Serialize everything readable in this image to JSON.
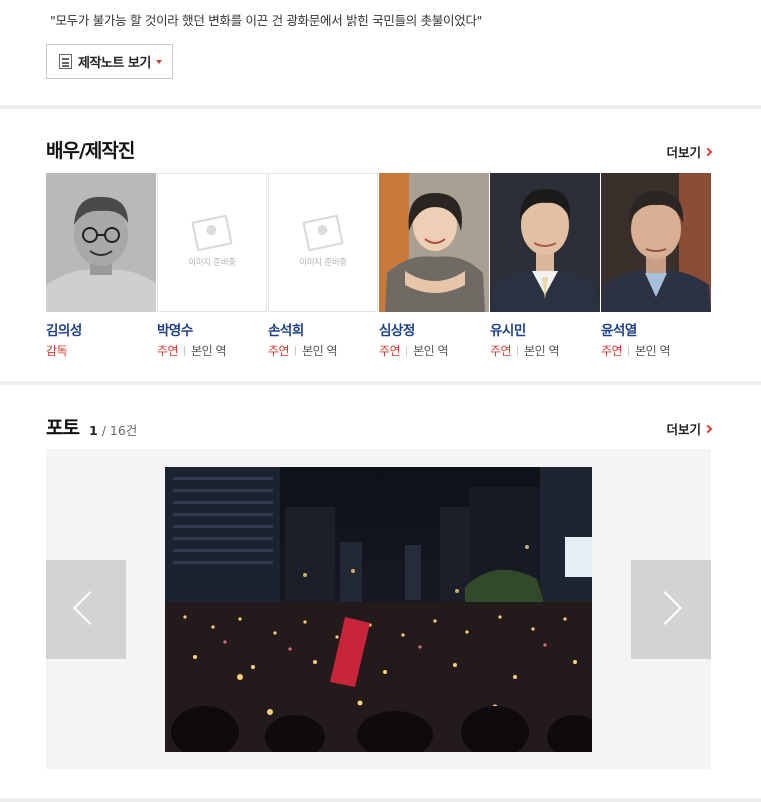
{
  "intro": {
    "quote": "\"모두가 불가능 할 것이라 했던 변화를 이끈 건 광화문에서 밝힌 국민들의 촛불이었다\"",
    "notes_button_label": "제작노트 보기"
  },
  "cast": {
    "title": "배우/제작진",
    "more_label": "더보기",
    "placeholder_text": "이미지 준비중",
    "items": [
      {
        "name": "김의성",
        "role": "감독",
        "character": ""
      },
      {
        "name": "박영수",
        "role": "주연",
        "character": "본인 역"
      },
      {
        "name": "손석희",
        "role": "주연",
        "character": "본인 역"
      },
      {
        "name": "심상정",
        "role": "주연",
        "character": "본인 역"
      },
      {
        "name": "유시민",
        "role": "주연",
        "character": "본인 역"
      },
      {
        "name": "윤석열",
        "role": "주연",
        "character": "본인 역"
      }
    ]
  },
  "photos": {
    "title": "포토",
    "current": "1",
    "total": "/ 16건",
    "more_label": "더보기"
  },
  "colors": {
    "accent_red": "#e4382f",
    "name_blue": "#1e3f8c"
  },
  "icons": [
    "document-icon",
    "caret-down-icon",
    "chevron-right-icon",
    "image-placeholder-icon",
    "arrow-left-icon",
    "arrow-right-icon"
  ]
}
